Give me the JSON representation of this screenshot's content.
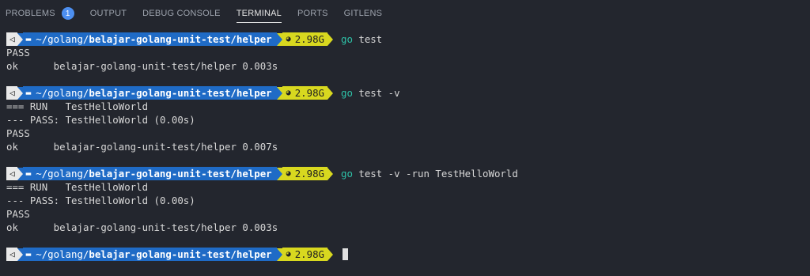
{
  "tabs": [
    {
      "label": "PROBLEMS",
      "badge": "1"
    },
    {
      "label": "OUTPUT"
    },
    {
      "label": "DEBUG CONSOLE"
    },
    {
      "label": "TERMINAL",
      "active": true
    },
    {
      "label": "PORTS"
    },
    {
      "label": "GITLENS"
    }
  ],
  "prompt": {
    "os_icon": "◁",
    "folder_icon": "folder-icon",
    "path_prefix": "~/golang/",
    "path_bold": "belajar-golang-unit-test/helper",
    "mem": "2.98G",
    "colors": {
      "path_bg": "#1f6bc6",
      "mem_bg": "#d8d81f",
      "cmd": "#2ec2a8"
    }
  },
  "blocks": [
    {
      "cmd": "go",
      "args": " test",
      "output": [
        "PASS",
        "ok      belajar-golang-unit-test/helper 0.003s"
      ]
    },
    {
      "cmd": "go",
      "args": " test -v",
      "output": [
        "=== RUN   TestHelloWorld",
        "--- PASS: TestHelloWorld (0.00s)",
        "PASS",
        "ok      belajar-golang-unit-test/helper 0.007s"
      ]
    },
    {
      "cmd": "go",
      "args": " test -v -run TestHelloWorld",
      "output": [
        "=== RUN   TestHelloWorld",
        "--- PASS: TestHelloWorld (0.00s)",
        "PASS",
        "ok      belajar-golang-unit-test/helper 0.003s"
      ]
    }
  ]
}
